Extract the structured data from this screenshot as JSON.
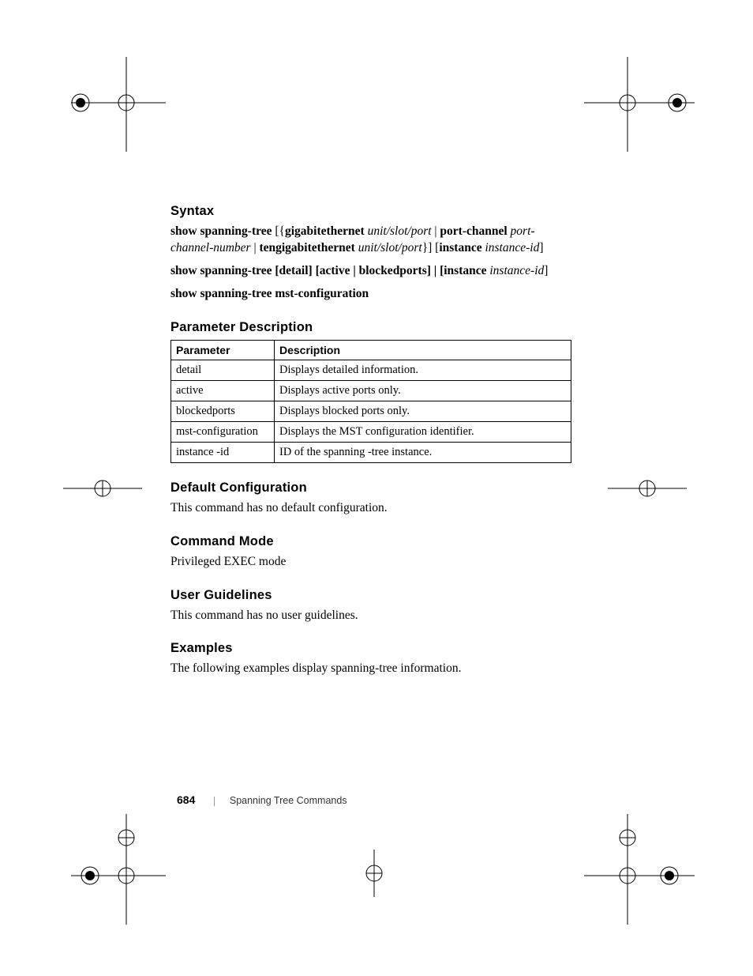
{
  "headings": {
    "syntax": "Syntax",
    "param_desc": "Parameter Description",
    "default_config": "Default Configuration",
    "command_mode": "Command Mode",
    "user_guidelines": "User Guidelines",
    "examples": "Examples"
  },
  "syntax": {
    "line1": {
      "cmd": "show spanning-tree",
      "lb": " [{",
      "kw1": "gigabitethernet",
      "arg1": " unit/slot/port",
      "sep1": " | ",
      "kw2": "port-channel",
      "arg2_a": " port-",
      "arg2_b": "channel-number",
      "sep2": " | ",
      "kw3": "tengigabitethernet",
      "arg3": " unit/slot/port",
      "rb": "}] [",
      "kw4": "instance",
      "arg4": " instance-id",
      "end": "]"
    },
    "line2": {
      "cmd": "show spanning-tree",
      "opt1": " [detail] [active | blockedports] | [instance ",
      "arg": "instance-id",
      "end": "]"
    },
    "line3": {
      "cmd": "show spanning-tree mst-configuration"
    }
  },
  "table": {
    "headers": {
      "param": "Parameter",
      "desc": "Description"
    },
    "rows": [
      {
        "param": "detail",
        "desc": "Displays detailed information."
      },
      {
        "param": "active",
        "desc": "Displays active ports only."
      },
      {
        "param": "blockedports",
        "desc": "Displays blocked ports only."
      },
      {
        "param": "mst-configuration",
        "desc": "Displays the MST configuration identifier."
      },
      {
        "param": "instance -id",
        "desc": "ID of the spanning -tree instance."
      }
    ]
  },
  "body": {
    "default_config": "This command has no default configuration.",
    "command_mode": "Privileged EXEC mode",
    "user_guidelines": "This command has no user guidelines.",
    "examples": "The following examples display spanning-tree information."
  },
  "footer": {
    "page_number": "684",
    "section_title": "Spanning Tree Commands"
  }
}
